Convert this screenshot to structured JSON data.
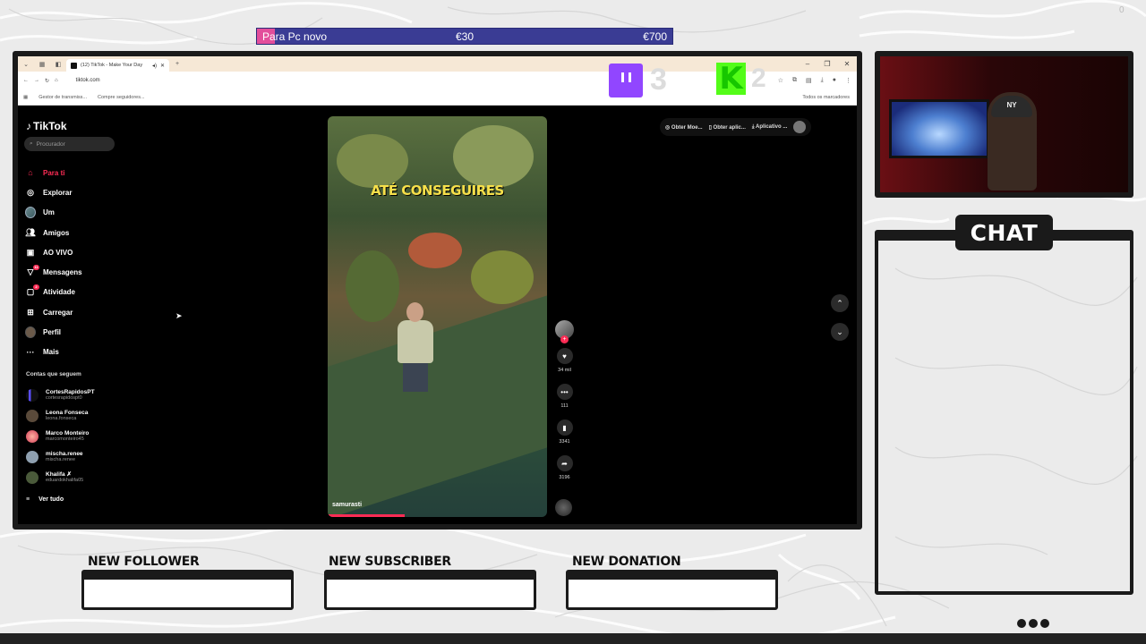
{
  "overlay": {
    "goal": {
      "title": "Para Pc novo",
      "current": "€30",
      "target": "€700",
      "progress": 0.043
    },
    "twitch_count": "3",
    "kick_count": "2",
    "chat_title": "CHAT",
    "alerts": {
      "follower": "NEW FOLLOWER",
      "subscriber": "NEW SUBSCRIBER",
      "donation": "NEW DONATION"
    },
    "corner_number": "0",
    "colors": {
      "goal_bg": "#3a3c94",
      "goal_fill": "#e34e9b",
      "twitch": "#9146ff",
      "kick": "#53fc18",
      "frame": "#1a1a1a"
    }
  },
  "browser": {
    "tab_title": "(12) TikTok - Make Your Day",
    "url": "tiktok.com",
    "bookmarks": [
      "Gestor de transmiss...",
      "Compre seguidores..."
    ],
    "bookmarks_right": "Todos os marcadores"
  },
  "tiktok": {
    "logo": "TikTok",
    "search_placeholder": "Procurador",
    "nav": [
      {
        "label": "Para ti",
        "icon": "home-icon",
        "active": true
      },
      {
        "label": "Explorar",
        "icon": "compass-icon"
      },
      {
        "label": "Um",
        "icon": "avatar-icon"
      },
      {
        "label": "Amigos",
        "icon": "friends-icon"
      },
      {
        "label": "AO VIVO",
        "icon": "live-icon"
      },
      {
        "label": "Mensagens",
        "icon": "messages-icon",
        "badge": "11"
      },
      {
        "label": "Atividade",
        "icon": "activity-icon",
        "badge": "2"
      },
      {
        "label": "Carregar",
        "icon": "upload-icon"
      },
      {
        "label": "Perfil",
        "icon": "profile-icon"
      },
      {
        "label": "Mais",
        "icon": "more-icon"
      }
    ],
    "following_heading": "Contas que seguem",
    "following": [
      {
        "name": "CortesRapidosPT",
        "handle": "cortesrapidospt0"
      },
      {
        "name": "Leona Fonseca",
        "handle": "leona.fonseca"
      },
      {
        "name": "Marco Monteiro",
        "handle": "marcomonteiro45"
      },
      {
        "name": "mischa.renee",
        "handle": "mischa.renee"
      },
      {
        "name": "Khalifa ✗",
        "handle": "eduardokhalifa05"
      }
    ],
    "see_all": "Ver tudo",
    "top_actions": [
      "Obter Moe...",
      "Obter aplic...",
      "Aplicativo ..."
    ],
    "video": {
      "caption": "ATÉ CONSEGUIRES",
      "username": "samurasti",
      "progress": 0.35
    },
    "actions": {
      "likes": "34 mil",
      "comments": "111",
      "saves": "3341",
      "shares": "3196"
    }
  }
}
